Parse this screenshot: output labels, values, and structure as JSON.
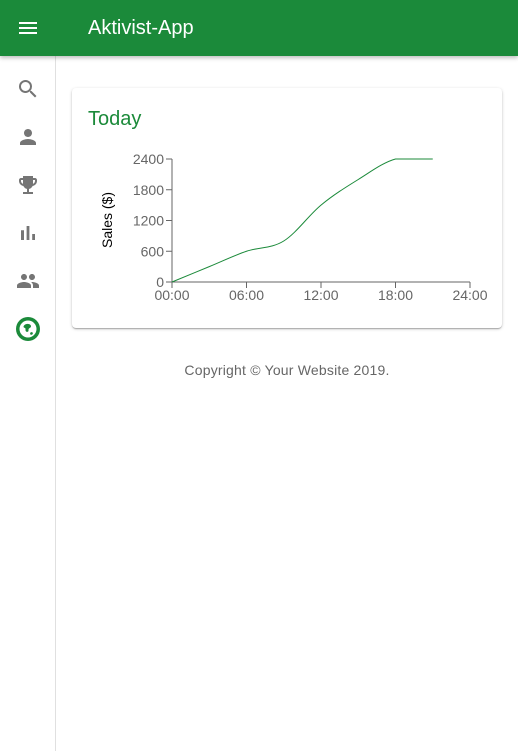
{
  "app_bar": {
    "title": "Aktivist-App",
    "menu_icon": "menu-icon",
    "color": "#1b8a3a"
  },
  "drawer": {
    "items": [
      {
        "icon": "search-icon"
      },
      {
        "icon": "person-icon"
      },
      {
        "icon": "trophy-icon"
      },
      {
        "icon": "bar-chart-icon"
      },
      {
        "icon": "people-icon"
      },
      {
        "icon": "globe-icon"
      }
    ]
  },
  "card": {
    "title": "Today"
  },
  "chart_data": {
    "type": "line",
    "title": "",
    "xlabel": "",
    "ylabel": "Sales ($)",
    "xlim": [
      0,
      24
    ],
    "ylim": [
      0,
      2400
    ],
    "x_ticks": [
      "00:00",
      "06:00",
      "12:00",
      "18:00",
      "24:00"
    ],
    "y_ticks": [
      "0",
      "600",
      "1200",
      "1800",
      "2400"
    ],
    "grid": false,
    "series": [
      {
        "color": "#1b8a3a",
        "points": [
          {
            "x": 0,
            "y": 0
          },
          {
            "x": 3,
            "y": 300
          },
          {
            "x": 6,
            "y": 600
          },
          {
            "x": 9,
            "y": 800
          },
          {
            "x": 12,
            "y": 1500
          },
          {
            "x": 15,
            "y": 2000
          },
          {
            "x": 18,
            "y": 2400
          },
          {
            "x": 21,
            "y": 2400
          }
        ]
      }
    ]
  },
  "footer": {
    "copyright": "Copyright © Your Website 2019."
  }
}
